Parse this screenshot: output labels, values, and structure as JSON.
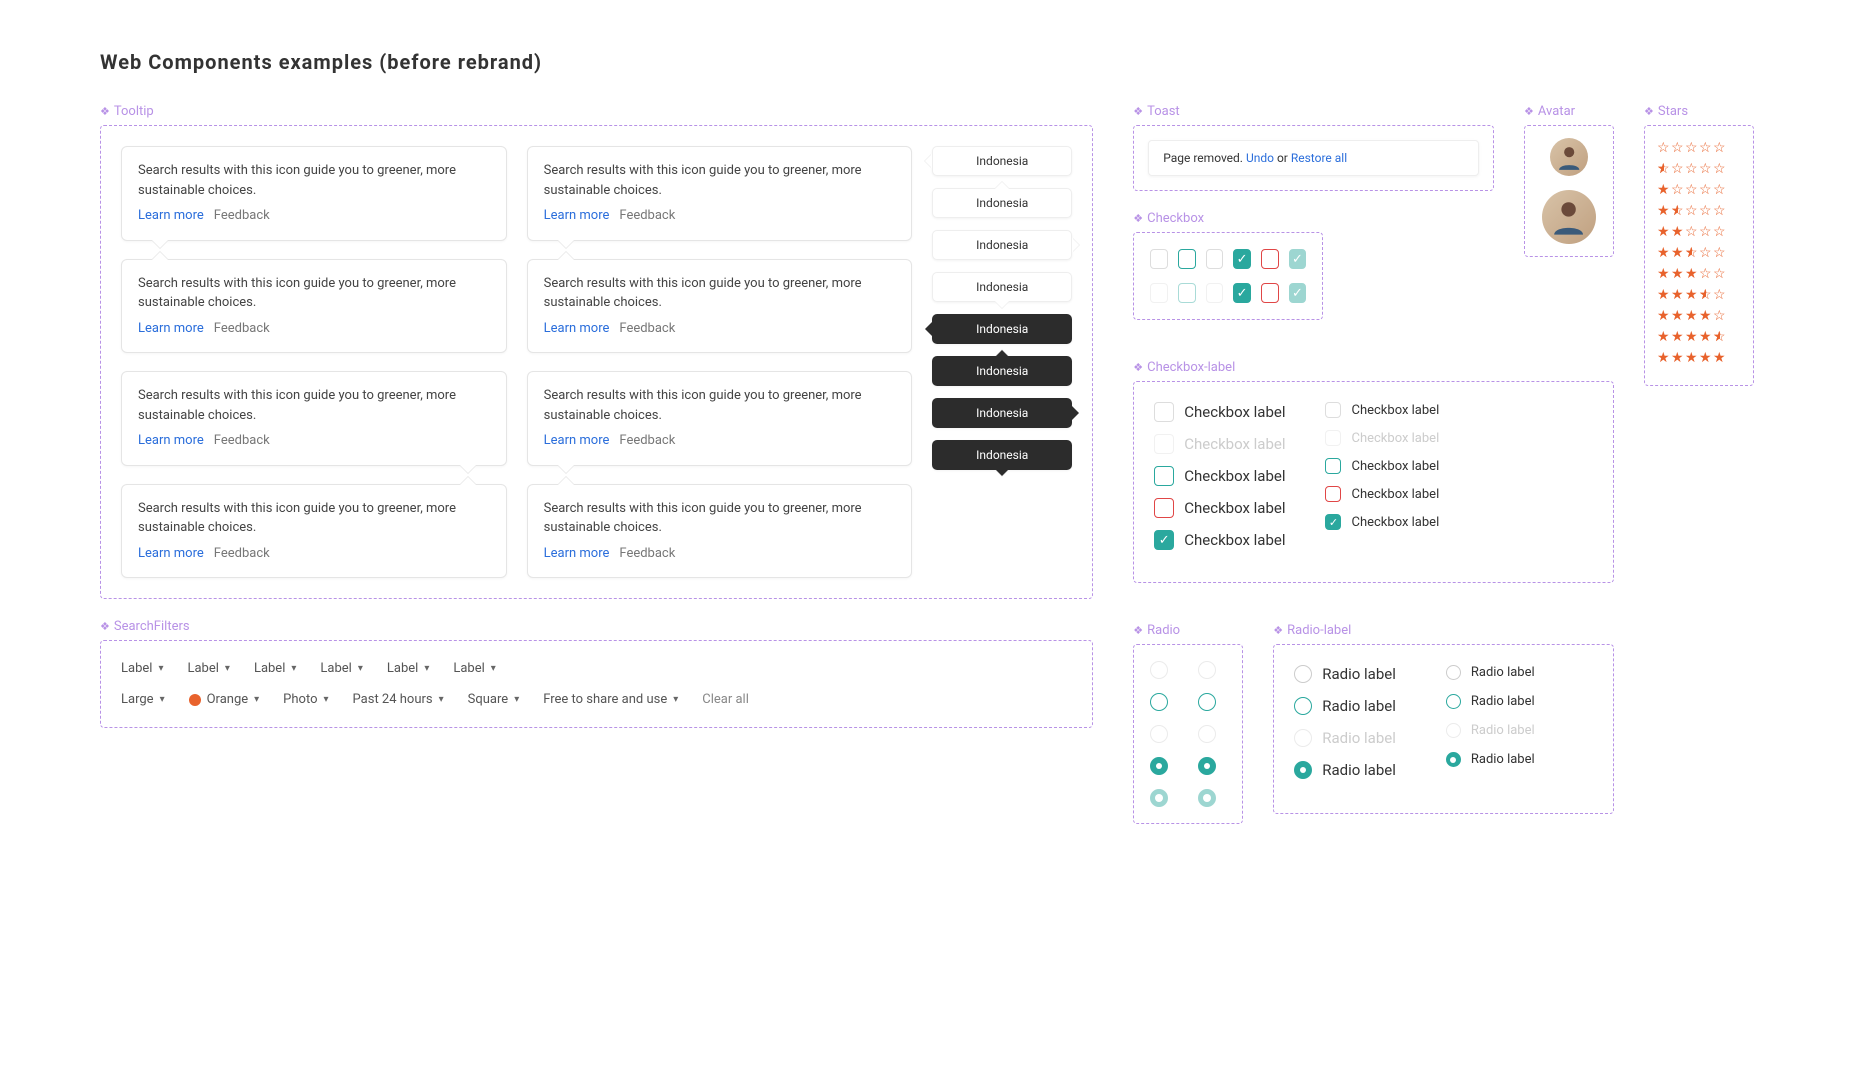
{
  "page_title_bold": "Web Components",
  "page_title_rest": " examples (before rebrand)",
  "sections": {
    "tooltip": "Tooltip",
    "searchfilters": "SearchFilters",
    "toast": "Toast",
    "checkbox": "Checkbox",
    "checkbox_label": "Checkbox-label",
    "radio": "Radio",
    "radio_label": "Radio-label",
    "avatar": "Avatar",
    "stars": "Stars"
  },
  "tooltip": {
    "body": "Search results with this icon guide you to greener, more sustainable choices.",
    "learn_more": "Learn more",
    "feedback": "Feedback",
    "pill_label": "Indonesia"
  },
  "searchfilters": {
    "generic": "Label",
    "large": "Large",
    "orange": "Orange",
    "orange_color": "#e8622c",
    "photo": "Photo",
    "past24": "Past 24 hours",
    "square": "Square",
    "free": "Free to share and use",
    "clear": "Clear all"
  },
  "toast": {
    "text": "Page removed. ",
    "undo": "Undo",
    "or": " or ",
    "restore": "Restore all"
  },
  "checkbox_label": {
    "text": "Checkbox label"
  },
  "radio_label": {
    "text": "Radio label"
  },
  "stars_ratings": [
    0,
    0.5,
    1,
    1.5,
    2,
    2.5,
    3,
    3.5,
    4,
    4.5,
    5
  ]
}
